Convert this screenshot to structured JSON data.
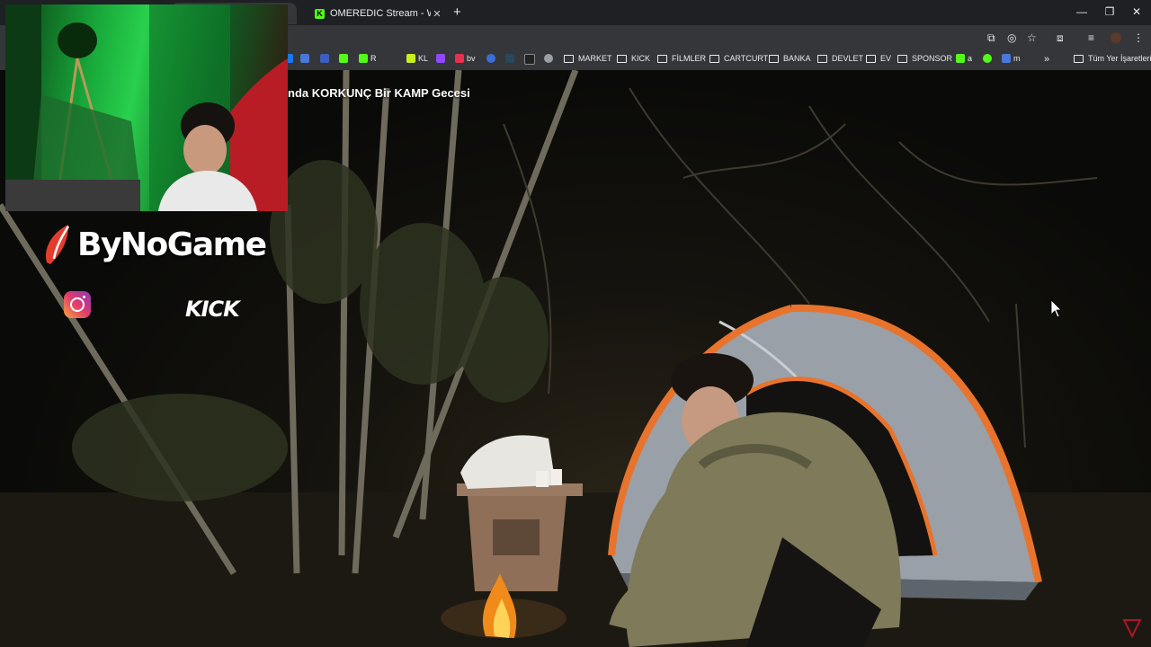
{
  "browser": {
    "tabs": [
      {
        "title": "",
        "active": true
      },
      {
        "title": "OMEREDIC Stream - Watch Live",
        "favicon_color": "#53fc18"
      }
    ],
    "bookmarks": [
      {
        "label": "R",
        "favicon_color": "#53fc18"
      },
      {
        "label": "KL",
        "favicon_color": "#c6f11c"
      },
      {
        "label": "bv",
        "favicon_color": "#e4314f"
      },
      {
        "label": "MARKET",
        "type": "folder"
      },
      {
        "label": "KICK",
        "type": "folder"
      },
      {
        "label": "FİLMLER",
        "type": "folder"
      },
      {
        "label": "CARTCURT",
        "type": "folder"
      },
      {
        "label": "BANKA",
        "type": "folder"
      },
      {
        "label": "DEVLET",
        "type": "folder"
      },
      {
        "label": "EV",
        "type": "folder"
      },
      {
        "label": "SPONSOR",
        "type": "folder"
      },
      {
        "label": "a",
        "favicon_color": "#53fc18"
      },
      {
        "label": "m",
        "favicon_color": "#4a78d8"
      }
    ],
    "all_bookmarks_label": "Tüm Yer İşaretleri"
  },
  "video": {
    "title_fragment": "nda KORKUNÇ Bir KAMP Gecesi"
  },
  "overlay": {
    "logo": "ByNoGame",
    "social": [
      "instagram-icon"
    ],
    "platform_logo": "KICK",
    "kick_text": "KICK"
  },
  "colors": {
    "chrome_dark": "#1f2023",
    "chrome_toolbar": "#35363a",
    "kick_green": "#53fc18",
    "tent_orange": "#e8732c",
    "tent_grey": "#9aa0a8"
  }
}
